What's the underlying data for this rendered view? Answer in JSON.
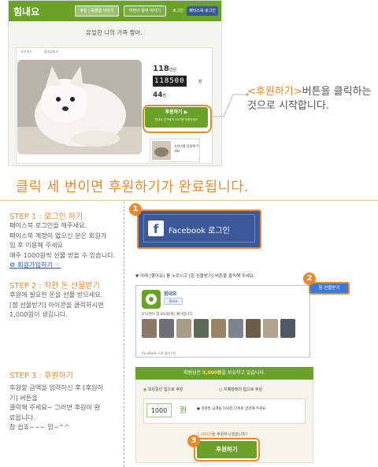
{
  "header": {
    "logo": "힘내요",
    "nav": [
      "후원 | 동물을 이야기",
      "어떤이 들여 이야기"
    ],
    "login_small": "로그인",
    "fb_login_small": "페이스북 로그인"
  },
  "screenshot": {
    "slogan": "유일한 나의 가족 짱아.",
    "tabs": [
      "사진보기",
      "동영상보기"
    ],
    "amount": "118",
    "amount_unit": "만원",
    "counter": "118500",
    "counter_unit": "원",
    "supporters": "44",
    "supporters_unit": "명",
    "donate_label": "후원하기 ▶",
    "donate_sub": "힘내요 친구에게 1000원 후원하세요",
    "thumb_caption": "사랑이를 응원해 주세요"
  },
  "callout": {
    "highlight": "<후원하기>",
    "rest": "버튼을 클릭하는 것으로 시작합니다."
  },
  "headline": "클릭 세 번이면 후원하기가 완료됩니다.",
  "step1": {
    "title": "STEP 1 : 로그인 하기",
    "lines": [
      "페이스북 로그인을 해주세요.",
      "페이스북 계정이 없으신 분은 회원가",
      "입 후 이용해 주세요",
      "매주 1000원씩 선물 받을 수 있습니다."
    ],
    "link": "회원가입하기 ☜",
    "fb_button": "Facebook 로그인",
    "badge": "1"
  },
  "step2": {
    "title": "STEP 2 : 착한 돈 선물받기",
    "lines": [
      "후원에 필요한 돈을 선물 받으세요.",
      "[힘 선물받기] 아이콘을 클릭하시면",
      "1,000원이 생깁니다."
    ],
    "note": "▼ 아래 [좋아요] 를 누르시고 [힘 선물받기] 버튼을 클릭해 주세요.",
    "gift_button": "힘 선물받기",
    "badge": "2",
    "widget_name": "힘내요",
    "widget_like": "좋아요",
    "widget_fans": "872명이 힘내요을(를) 좋아합니다.",
    "widget_footer": "Facebook 소셜 플러그인"
  },
  "step3": {
    "title": "STEP 3 : 후원하기",
    "lines": [
      "후원할 금액을 입력하신 후 [후원하",
      "기] 버튼을",
      "클릭해 주세요~ 그러면 후원이 완",
      "료됩니다.",
      "참 쉽죠~~~ 잉~^^"
    ],
    "form_head_prefix": "회원님은",
    "form_head_amount": "5,000원",
    "form_head_suffix": "을 보유하고 있습니다.",
    "radio1": "보유중인 힘으로 후원",
    "radio2": "지폐형태의 힘으로 후원",
    "amount_value": "1000",
    "won": "원",
    "amount_hint": "후원할 금액을 500힘 단위로 입력해 주세요.",
    "balance_amount": "1,000원",
    "balance_rest": "을 후원하시겠습니까?",
    "donate_button": "후원하기",
    "badge": "3"
  },
  "colors": {
    "accent": "#e8892b",
    "green": "#6aa227",
    "facebook": "#3b5998"
  }
}
